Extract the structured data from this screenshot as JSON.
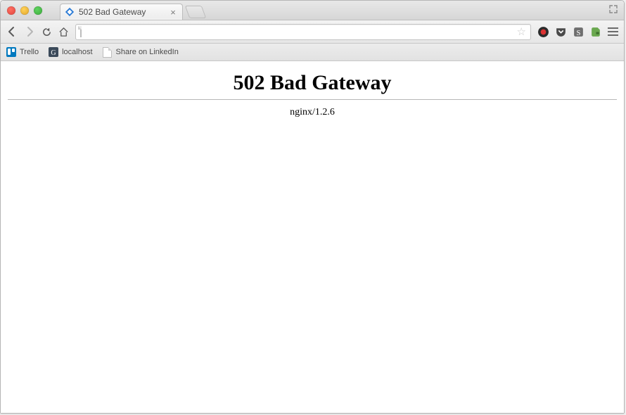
{
  "tab": {
    "title": "502 Bad Gateway"
  },
  "bookmarks": {
    "items": [
      {
        "label": "Trello"
      },
      {
        "label": "localhost"
      },
      {
        "label": "Share on LinkedIn"
      }
    ]
  },
  "page": {
    "heading": "502 Bad Gateway",
    "server": "nginx/1.2.6"
  }
}
